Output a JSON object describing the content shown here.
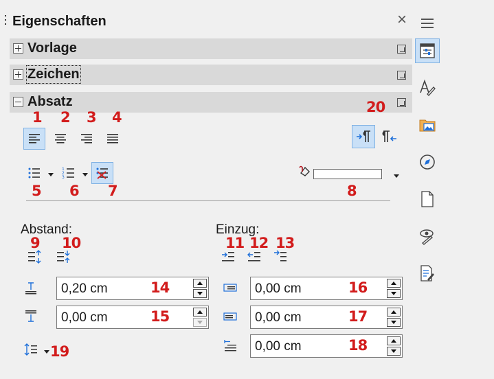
{
  "deck": {
    "title": "Eigenschaften",
    "close_label": "×",
    "sections": [
      {
        "label": "Vorlage",
        "expanded": false
      },
      {
        "label": "Zeichen",
        "expanded": false
      },
      {
        "label": "Absatz",
        "expanded": true
      }
    ]
  },
  "badges": {
    "b1": "1",
    "b2": "2",
    "b3": "3",
    "b4": "4",
    "b5": "5",
    "b6": "6",
    "b7": "7",
    "b8": "8",
    "b9": "9",
    "b10": "10",
    "b11": "11",
    "b12": "12",
    "b13": "13",
    "b14": "14",
    "b15": "15",
    "b16": "16",
    "b17": "17",
    "b18": "18",
    "b19": "19",
    "b20": "20"
  },
  "spacing": {
    "label": "Abstand:",
    "above_value": "0,20 cm",
    "below_value": "0,00 cm"
  },
  "indent": {
    "label": "Einzug:",
    "before_value": "0,00 cm",
    "after_value": "0,00 cm",
    "first_line_value": "0,00 cm"
  },
  "colors": {
    "accent": "#c9e0f7",
    "accent_border": "#7fb1e3",
    "badge": "#d21c1c",
    "section_bg": "#d9d9d9",
    "panel_bg": "#f0f0f0",
    "icon_blue": "#1e6fd9",
    "icon_orange": "#e89a2c"
  },
  "icons": {
    "align": [
      "align-left-icon",
      "align-center-icon",
      "align-right-icon",
      "align-justify-icon"
    ],
    "direction": [
      "ltr-paragraph-icon",
      "rtl-paragraph-icon"
    ],
    "lists": [
      "unordered-list-icon",
      "ordered-list-icon",
      "no-list-icon"
    ],
    "tabs": [
      "properties-tab-icon",
      "styles-tab-icon",
      "gallery-tab-icon",
      "navigator-tab-icon",
      "page-tab-icon",
      "style-inspector-tab-icon",
      "manage-changes-tab-icon"
    ]
  }
}
